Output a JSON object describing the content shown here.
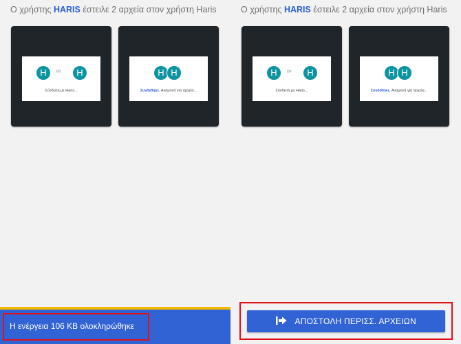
{
  "colors": {
    "accent": "#3263d4",
    "username": "#2c5fd1",
    "avatar": "#0d94a0",
    "card": "#1f2529",
    "highlight": "#e0101a",
    "progress_line": "#f5b800"
  },
  "panels": [
    {
      "header": {
        "prefix": "Ο χρήστης",
        "user": "HARIS",
        "suffix": "έστειλε 2 αρχεία στον χρήστη Haris"
      },
      "cards": [
        {
          "avatar_left": "H",
          "arrows": "›››",
          "avatar_right": "H",
          "status_highlight": "",
          "status_text": "Σύνδεση με Haris..."
        },
        {
          "avatar_left": "H",
          "avatar_right": "H",
          "status_highlight": "Συνδέθηκε.",
          "status_text": "Αναμονή για αρχεία..."
        }
      ]
    },
    {
      "header": {
        "prefix": "Ο χρήστης",
        "user": "HARIS",
        "suffix": "έστειλε 2 αρχεία στον χρήστη Haris"
      },
      "cards": [
        {
          "avatar_left": "H",
          "arrows": "›››",
          "avatar_right": "H",
          "status_highlight": "",
          "status_text": "Σύνδεση με Haris..."
        },
        {
          "avatar_left": "H",
          "avatar_right": "H",
          "status_highlight": "Συνδέθηκε.",
          "status_text": "Αναμονή για αρχεία..."
        }
      ]
    }
  ],
  "status_bar": {
    "text": "Η ενέργεια 106 KB ολοκληρώθηκε"
  },
  "send_button": {
    "label": "ΑΠΟΣΤΟΛΗ ΠΕΡΙΣΣ. ΑΡΧΕΙΩΝ",
    "icon": "send-file-icon"
  }
}
